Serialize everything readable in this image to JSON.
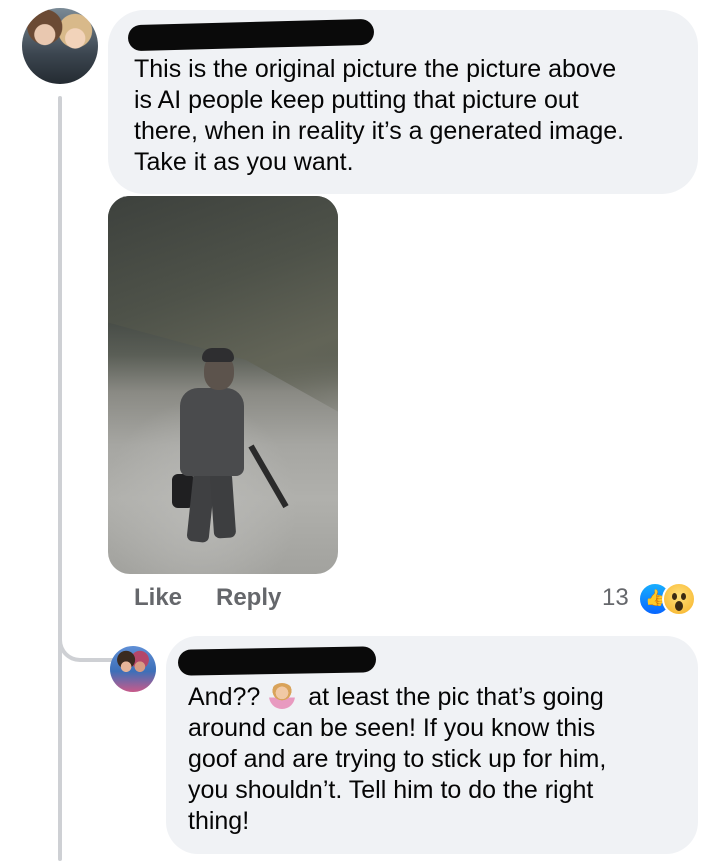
{
  "comment_main": {
    "text": "This is the original picture the picture above\nis AI people keep putting that picture out\nthere, when in reality it’s a generated image.\nTake it as you want.",
    "actions": {
      "like_label": "Like",
      "reply_label": "Reply"
    },
    "reactions": {
      "count": "13",
      "types": [
        "like-icon",
        "wow-icon"
      ]
    }
  },
  "reply": {
    "text_before_emoji": "And?? ",
    "emoji": "person-shrugging-emoji",
    "text_after_emoji": " at least the pic that’s going\naround can be seen! If you know this\ngoof and are trying to stick up for him,\nyou shouldn’t. Tell him to do the right\nthing!"
  },
  "colors": {
    "bubble": "#f0f2f5",
    "action_text": "#65676b",
    "like_blue": "#0866ff",
    "thread_line": "#ced0d4"
  }
}
